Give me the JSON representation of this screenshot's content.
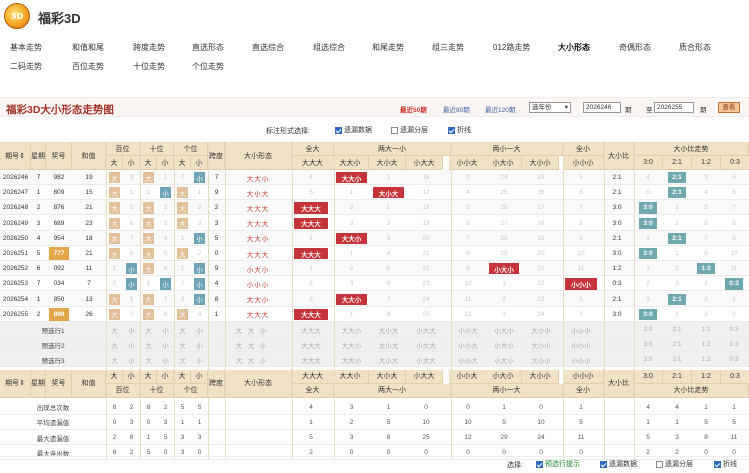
{
  "app": {
    "title": "福彩3D",
    "logo_text": "3D"
  },
  "nav": {
    "row1": [
      "基本走势",
      "和值和尾",
      "跨度走势",
      "直选形态",
      "直选综合",
      "组选综合",
      "和尾走势",
      "组三走势",
      "012路走势",
      "大小形态",
      "奇偶形态",
      "质合形态"
    ],
    "row2": [
      "二码走势",
      "百位走势",
      "十位走势",
      "个位走势"
    ],
    "active": "大小形态"
  },
  "panel": {
    "title": "福彩3D大小形态走势图",
    "ranges": [
      "最近50期",
      "最近80期",
      "最近120期"
    ],
    "active_range": "最近50期",
    "select_value": "选年份",
    "from_issue": "2026246",
    "issue_label": "期",
    "to_label": "至",
    "to_issue": "2026255",
    "query_label": "查看"
  },
  "options": {
    "label": "标注形式选择:",
    "items": [
      {
        "label": "遗漏数据",
        "checked": true
      },
      {
        "label": "遗漏分层",
        "checked": false
      },
      {
        "label": "折线",
        "checked": true
      }
    ]
  },
  "table": {
    "head_groups": {
      "issue": "期号",
      "week": "星期",
      "award": "奖号",
      "sum": "和值",
      "hundreds": "百位",
      "tens": "十位",
      "units": "个位",
      "span": "跨度",
      "form": "大小形态",
      "all_big": "全大",
      "two_small_one_big_hdr": "两大一小",
      "two_big_one_small_hdr": "两小一大",
      "all_small": "全小",
      "ratio": "大小比",
      "ratio_trend": "大小比走势",
      "sort_mark": "⇕"
    },
    "sub_heads": {
      "big": "大",
      "small": "小",
      "all_big_cols": [
        "大大大"
      ],
      "two_big_cols": [
        "大大小",
        "大小大",
        "小大大"
      ],
      "two_small_cols": [
        "小小大",
        "小大小",
        "大小小"
      ],
      "all_small_cols": [
        "小小小"
      ],
      "ratio_cols": [
        "3:0",
        "2:1",
        "1:2",
        "0:3"
      ]
    },
    "rows": [
      {
        "issue": "2026246",
        "week": "7",
        "award": "982",
        "sum": "19",
        "h": [
          "大",
          "3"
        ],
        "t": [
          "大",
          "1"
        ],
        "u": [
          "7",
          "小"
        ],
        "span": "7",
        "form": "大大小",
        "fb": "4",
        "tb": [
          "大大小",
          "1",
          "16"
        ],
        "ts": [
          "3",
          "24",
          "15"
        ],
        "fs": "5",
        "ratio": "2:1",
        "rt": [
          "4",
          "2:1",
          "3",
          "5"
        ]
      },
      {
        "issue": "2026247",
        "week": "1",
        "award": "609",
        "sales": "",
        "sum": "15",
        "h": [
          "大",
          "1"
        ],
        "t": [
          "1",
          "小"
        ],
        "u": [
          "大",
          "1"
        ],
        "span": "9",
        "form": "大小大",
        "fb": "5",
        "tb": [
          "1",
          "大小大",
          "17"
        ],
        "ts": [
          "4",
          "25",
          "16"
        ],
        "fs": "6",
        "ratio": "2:1",
        "rt": [
          "5",
          "2:1",
          "4",
          "6"
        ]
      },
      {
        "issue": "2026248",
        "week": "2",
        "award": "876",
        "sum": "21",
        "h": [
          "大",
          "5"
        ],
        "t": [
          "大",
          "2"
        ],
        "u": [
          "大",
          "2"
        ],
        "span": "2",
        "form": "大大大",
        "fb": "大大大",
        "tb": [
          "2",
          "1",
          "18"
        ],
        "ts": [
          "5",
          "26",
          "17"
        ],
        "fs": "7",
        "ratio": "3:0",
        "rt": [
          "3:0",
          "1",
          "5",
          "7"
        ]
      },
      {
        "issue": "2026249",
        "week": "3",
        "award": "689",
        "sum": "23",
        "h": [
          "大",
          "6"
        ],
        "t": [
          "大",
          "3"
        ],
        "u": [
          "大",
          "3"
        ],
        "span": "3",
        "form": "大大大",
        "fb": "大大大",
        "tb": [
          "3",
          "2",
          "19"
        ],
        "ts": [
          "6",
          "27",
          "18"
        ],
        "fs": "8",
        "ratio": "3:0",
        "rt": [
          "3:0",
          "2",
          "6",
          "8"
        ]
      },
      {
        "issue": "2026250",
        "week": "4",
        "award": "954",
        "sum": "18",
        "h": [
          "大",
          "7"
        ],
        "t": [
          "大",
          "4"
        ],
        "u": [
          "1",
          "小"
        ],
        "span": "5",
        "form": "大大小",
        "fb": "1",
        "tb": [
          "大大小",
          "3",
          "20"
        ],
        "ts": [
          "7",
          "28",
          "19"
        ],
        "fs": "9",
        "ratio": "2:1",
        "rt": [
          "1",
          "2:1",
          "7",
          "9"
        ]
      },
      {
        "issue": "2026251",
        "week": "5",
        "award": "777",
        "sum": "21",
        "h": [
          "大",
          "8"
        ],
        "t": [
          "大",
          "5"
        ],
        "u": [
          "大",
          "2"
        ],
        "span": "0",
        "form": "大大大",
        "fb": "大大大",
        "tb": [
          "1",
          "4",
          "21"
        ],
        "ts": [
          "8",
          "29",
          "20"
        ],
        "fs": "10",
        "ratio": "3:0",
        "rt": [
          "3:0",
          "1",
          "8",
          "10"
        ]
      },
      {
        "issue": "2026252",
        "week": "6",
        "award": "092",
        "sum": "11",
        "h": [
          "1",
          "小"
        ],
        "t": [
          "大",
          "6"
        ],
        "u": [
          "1",
          "小"
        ],
        "span": "9",
        "form": "小大小",
        "fb": "1",
        "tb": [
          "2",
          "5",
          "22"
        ],
        "ts": [
          "9",
          "小大小",
          "21"
        ],
        "fs": "11",
        "ratio": "1:2",
        "rt": [
          "1",
          "2",
          "1:2",
          "11"
        ]
      },
      {
        "issue": "2026253",
        "week": "7",
        "award": "034",
        "sum": "7",
        "h": [
          "2",
          "小"
        ],
        "t": [
          "1",
          "小"
        ],
        "u": [
          "2",
          "小"
        ],
        "span": "4",
        "form": "小小小",
        "fb": "2",
        "tb": [
          "3",
          "6",
          "23"
        ],
        "ts": [
          "10",
          "1",
          "22"
        ],
        "fs": "小小小",
        "ratio": "0:3",
        "rt": [
          "2",
          "3",
          "1",
          "0:3"
        ]
      },
      {
        "issue": "2026254",
        "week": "1",
        "award": "850",
        "sum": "13",
        "h": [
          "大",
          "1"
        ],
        "t": [
          "大",
          "7"
        ],
        "u": [
          "3",
          "小"
        ],
        "span": "8",
        "form": "大大小",
        "fb": "3",
        "tb": [
          "大大小",
          "7",
          "24"
        ],
        "ts": [
          "11",
          "2",
          "23"
        ],
        "fs": "1",
        "ratio": "2:1",
        "rt": [
          "3",
          "2:1",
          "2",
          "1"
        ]
      },
      {
        "issue": "2026255",
        "week": "2",
        "award": "899",
        "sum": "26",
        "h": [
          "大",
          "2"
        ],
        "t": [
          "大",
          "8"
        ],
        "u": [
          "大",
          "4"
        ],
        "span": "1",
        "form": "大大大",
        "fb": "大大大",
        "tb": [
          "1",
          "8",
          "25"
        ],
        "ts": [
          "12",
          "3",
          "24"
        ],
        "fs": "2",
        "ratio": "3:0",
        "rt": [
          "3:0",
          "1",
          "3",
          "2"
        ]
      }
    ],
    "highlight_awards": [
      "777",
      "899"
    ],
    "preview_rows": [
      {
        "label": "预选行1",
        "h": [
          "大",
          "小"
        ],
        "t": [
          "大",
          "小"
        ],
        "u": [
          "大",
          "小"
        ],
        "form": [
          "大",
          "大",
          "小"
        ],
        "fb": "大大大",
        "tb": [
          "大大小",
          "大小大",
          "小大大"
        ],
        "ts": [
          "小小大",
          "小大小",
          "大小小"
        ],
        "fs": "小小小",
        "rt": [
          "3:0",
          "2:1",
          "1:2",
          "0:3"
        ]
      },
      {
        "label": "预选行2",
        "h": [
          "大",
          "小"
        ],
        "t": [
          "大",
          "小"
        ],
        "u": [
          "大",
          "小"
        ],
        "form": [
          "大",
          "大",
          "小"
        ],
        "fb": "大大大",
        "tb": [
          "大大小",
          "大小大",
          "小大大"
        ],
        "ts": [
          "小小大",
          "小大小",
          "大小小"
        ],
        "fs": "小小小",
        "rt": [
          "3:0",
          "2:1",
          "1:2",
          "0:3"
        ]
      },
      {
        "label": "预选行3",
        "h": [
          "大",
          "小"
        ],
        "t": [
          "大",
          "小"
        ],
        "u": [
          "大",
          "小"
        ],
        "form": [
          "大",
          "大",
          "小"
        ],
        "fb": "大大大",
        "tb": [
          "大大小",
          "大小大",
          "小大大"
        ],
        "ts": [
          "小小大",
          "小大小",
          "大小小"
        ],
        "fs": "小小小",
        "rt": [
          "3:0",
          "2:1",
          "1:2",
          "0:3"
        ]
      }
    ],
    "stats": [
      {
        "label": "出现总次数",
        "v": [
          "8",
          "2",
          "8",
          "2",
          "5",
          "5"
        ],
        "fb": "4",
        "tb": [
          "3",
          "1",
          "0"
        ],
        "ts": [
          "0",
          "1",
          "0"
        ],
        "fs": "1",
        "rt": [
          "4",
          "4",
          "1",
          "1"
        ]
      },
      {
        "label": "平均遗漏值",
        "v": [
          "0",
          "3",
          "0",
          "3",
          "1",
          "1"
        ],
        "fb": "1",
        "tb": [
          "2",
          "5",
          "10"
        ],
        "ts": [
          "10",
          "5",
          "10"
        ],
        "fs": "5",
        "rt": [
          "1",
          "1",
          "5",
          "5"
        ]
      },
      {
        "label": "最大遗漏值",
        "v": [
          "2",
          "8",
          "1",
          "5",
          "3",
          "3"
        ],
        "fb": "5",
        "tb": [
          "3",
          "8",
          "25"
        ],
        "ts": [
          "12",
          "29",
          "24"
        ],
        "fs": "11",
        "rt": [
          "5",
          "3",
          "8",
          "11"
        ]
      },
      {
        "label": "最大连出数",
        "v": [
          "6",
          "2",
          "5",
          "0",
          "3",
          "0"
        ],
        "fb": "2",
        "tb": [
          "0",
          "0",
          "0"
        ],
        "ts": [
          "0",
          "0",
          "0"
        ],
        "fs": "0",
        "rt": [
          "2",
          "2",
          "0",
          "0"
        ]
      }
    ]
  },
  "footer": {
    "label": "选择:",
    "items": [
      {
        "label": "预选行提示",
        "checked": true,
        "color": "#1a8a2a"
      },
      {
        "label": "遗漏数据",
        "checked": true,
        "color": "#333"
      },
      {
        "label": "遗漏分层",
        "checked": false,
        "color": "#333"
      },
      {
        "label": "折线",
        "checked": true,
        "color": "#333"
      }
    ]
  }
}
